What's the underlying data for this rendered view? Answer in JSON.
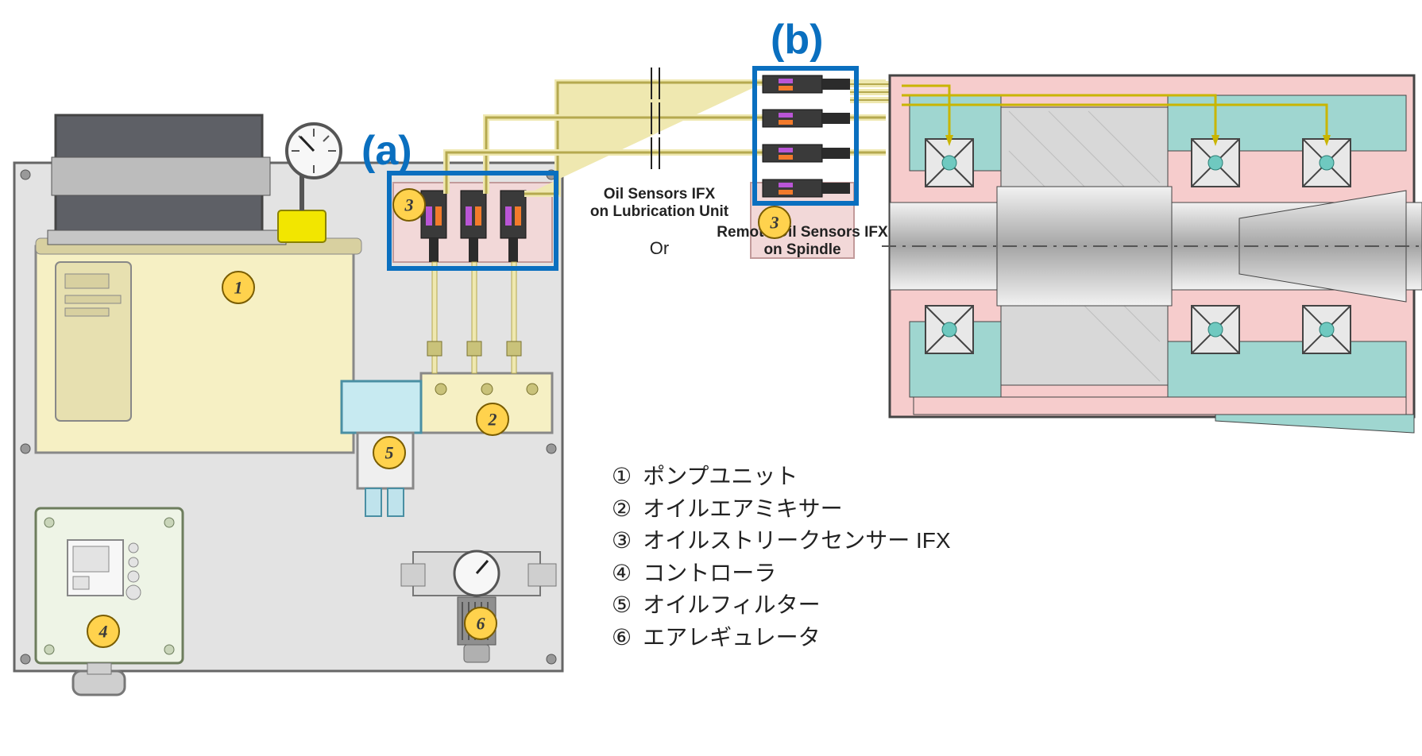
{
  "callouts": {
    "a": "(a)",
    "b": "(b)"
  },
  "balloons": {
    "b1": "1",
    "b2": "2",
    "b3": "3",
    "b3r": "3",
    "b4": "4",
    "b5": "5",
    "b6": "6"
  },
  "sensor_labels": {
    "left_line1": "Oil Sensors IFX",
    "left_line2": "on Lubrication Unit",
    "or": "Or",
    "right_line1": "Remote Oil Sensors IFX",
    "right_line2": "on Spindle"
  },
  "legend": {
    "n1": "①",
    "t1": "ポンプユニット",
    "n2": "②",
    "t2": "オイルエアミキサー",
    "n3": "③",
    "t3": "オイルストリークセンサー IFX",
    "n4": "④",
    "t4": "コントローラ",
    "n5": "⑤",
    "t5": "オイルフィルター",
    "n6": "⑥",
    "t6": "エアレギュレータ"
  }
}
